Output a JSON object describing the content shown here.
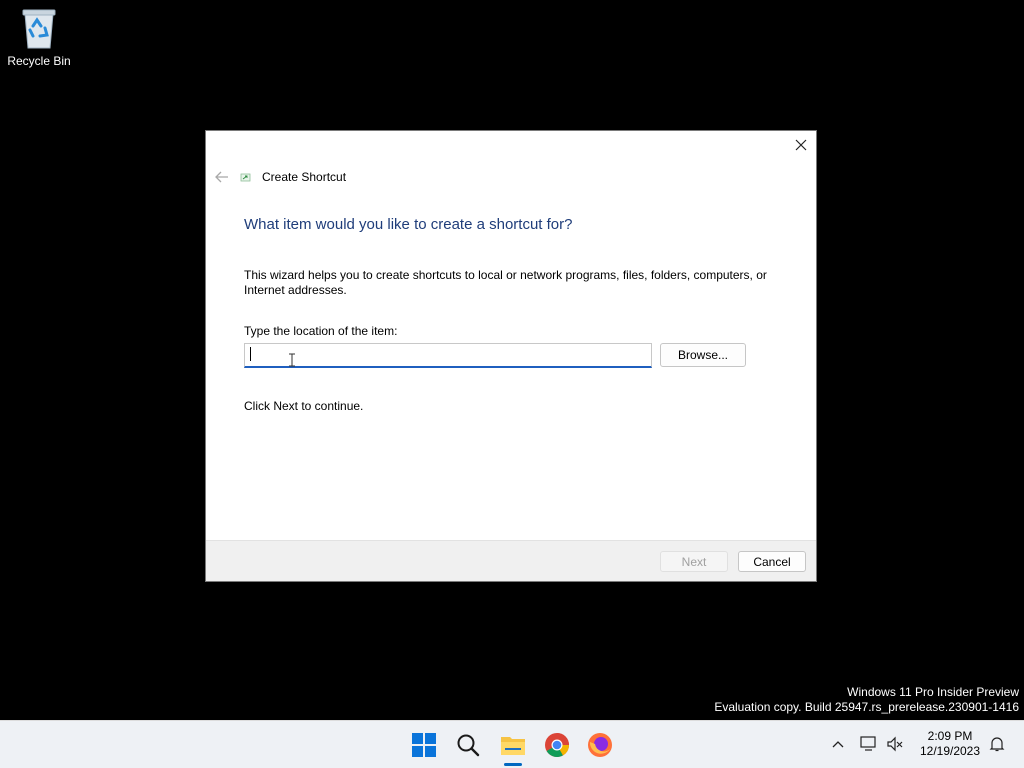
{
  "desktop": {
    "recycle_bin_label": "Recycle Bin",
    "watermark": {
      "line1": "Windows 11 Pro Insider Preview",
      "line2": "Evaluation copy. Build 25947.rs_prerelease.230901-1416"
    }
  },
  "dialog": {
    "title": "Create Shortcut",
    "heading": "What item would you like to create a shortcut for?",
    "description": "This wizard helps you to create shortcuts to local or network programs, files, folders, computers, or Internet addresses.",
    "location_label": "Type the location of the item:",
    "location_value": "",
    "location_placeholder": "",
    "browse_label": "Browse...",
    "continue_text": "Click Next to continue.",
    "next_label": "Next",
    "cancel_label": "Cancel",
    "next_enabled": false
  },
  "taskbar": {
    "icons": [
      "start-icon",
      "search-icon",
      "file-explorer-icon",
      "chrome-icon",
      "firefox-icon"
    ],
    "active": "file-explorer-icon",
    "tray_icons": [
      "chevron-up-icon",
      "network-icon",
      "volume-muted-icon",
      "notification-bell-icon"
    ],
    "time": "2:09 PM",
    "date": "12/19/2023"
  },
  "colors": {
    "heading": "#1f3d7a",
    "accent": "#0067c0",
    "desktop_bg": "#000000",
    "taskbar_bg": "#eef1f5"
  }
}
